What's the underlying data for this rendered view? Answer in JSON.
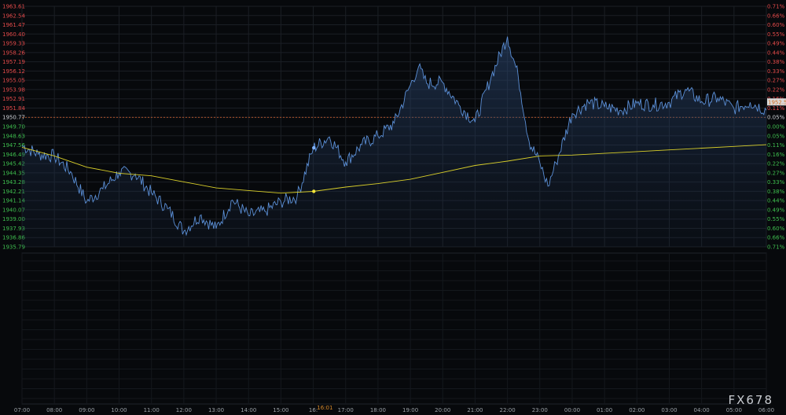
{
  "brand": "FX678",
  "colors": {
    "price_line": "#5b8fd6",
    "ma_line": "#d9cf2a",
    "up_label": "#e24a4a",
    "down_label": "#3fbf4f",
    "prev_close_label": "#cfd3d8",
    "ref_line": "#e2692e",
    "last_tag_bg": "#d9d9d9",
    "last_tag_text": "#d06a1c",
    "grid": "#1b1f25"
  },
  "chart_data": {
    "type": "line",
    "title": "",
    "xlabel": "",
    "ylabel": "",
    "ylim": [
      1935.79,
      1963.61
    ],
    "prev_close": 1950.77,
    "last_price": "1952.50",
    "y_ticks": [
      "1963.61",
      "1962.54",
      "1961.47",
      "1960.40",
      "1959.33",
      "1958.26",
      "1957.19",
      "1956.12",
      "1955.05",
      "1953.98",
      "1952.91",
      "1951.84",
      "1950.77",
      "1949.70",
      "1948.63",
      "1947.56",
      "1946.49",
      "1945.42",
      "1944.35",
      "1943.28",
      "1942.21",
      "1941.14",
      "1940.07",
      "1939.00",
      "1937.93",
      "1936.86",
      "1935.79"
    ],
    "pct_ticks": [
      "0.71%",
      "0.66%",
      "0.60%",
      "0.55%",
      "0.49%",
      "0.44%",
      "0.38%",
      "0.33%",
      "0.27%",
      "0.22%",
      "0.16%",
      "0.11%",
      "0.05%",
      "0.00%",
      "0.05%",
      "0.11%",
      "0.16%",
      "0.22%",
      "0.27%",
      "0.33%",
      "0.38%",
      "0.44%",
      "0.49%",
      "0.55%",
      "0.60%",
      "0.66%",
      "0.71%"
    ],
    "x_ticks": [
      "07:00",
      "08:00",
      "09:00",
      "10:00",
      "11:00",
      "12:00",
      "13:00",
      "14:00",
      "15:00",
      "16:",
      "17:00",
      "18:00",
      "19:00",
      "20:00",
      "21:00",
      "22:00",
      "23:00",
      "00:00",
      "01:00",
      "02:00",
      "03:00",
      "04:00",
      "05:00",
      "06:00"
    ],
    "marker_time": "16:01",
    "series": [
      {
        "x": [
          "07:00",
          "07:30",
          "08:00",
          "08:30",
          "09:00",
          "09:30",
          "10:00",
          "10:30",
          "11:00",
          "11:30",
          "12:00",
          "12:30",
          "13:00",
          "13:30",
          "14:00",
          "14:30",
          "15:00",
          "15:30",
          "16:00",
          "16:30",
          "17:00",
          "17:30",
          "18:00",
          "18:30",
          "19:00",
          "19:15",
          "19:30",
          "20:00",
          "20:30",
          "21:00",
          "21:30",
          "22:00",
          "22:20",
          "22:40",
          "23:00",
          "23:15",
          "23:30",
          "00:00",
          "00:30",
          "01:00",
          "01:30",
          "02:00",
          "02:30",
          "03:00",
          "03:30",
          "04:00",
          "04:30",
          "05:00",
          "05:30",
          "06:00"
        ],
        "values": [
          1947.5,
          1946.5,
          1946.3,
          1944.5,
          1941.0,
          1942.5,
          1944.4,
          1944.2,
          1942.0,
          1940.2,
          1937.6,
          1939.4,
          1937.9,
          1941.2,
          1939.4,
          1939.9,
          1941.0,
          1941.6,
          1947.2,
          1948.5,
          1945.6,
          1947.6,
          1948.6,
          1950.1,
          1954.5,
          1956.6,
          1954.7,
          1954.8,
          1952.2,
          1950.2,
          1955.5,
          1960.1,
          1955.5,
          1948.0,
          1945.5,
          1942.8,
          1945.5,
          1951.2,
          1952.5,
          1952.0,
          1951.6,
          1952.4,
          1952.2,
          1952.5,
          1954.0,
          1952.6,
          1953.0,
          1951.8,
          1952.5,
          1951.6
        ]
      },
      {
        "x": [
          "07:00",
          "08:00",
          "09:00",
          "10:00",
          "11:00",
          "12:00",
          "13:00",
          "14:00",
          "15:00",
          "16:00",
          "17:00",
          "18:00",
          "19:00",
          "20:00",
          "21:00",
          "22:00",
          "23:00",
          "00:00",
          "01:00",
          "02:00",
          "03:00",
          "04:00",
          "05:00",
          "06:00"
        ],
        "values": [
          1947.3,
          1946.3,
          1945.0,
          1944.3,
          1944.0,
          1943.3,
          1942.6,
          1942.3,
          1942.0,
          1942.2,
          1942.7,
          1943.1,
          1943.6,
          1944.4,
          1945.2,
          1945.7,
          1946.3,
          1946.4,
          1946.6,
          1946.8,
          1947.0,
          1947.2,
          1947.4,
          1947.6
        ]
      }
    ]
  }
}
